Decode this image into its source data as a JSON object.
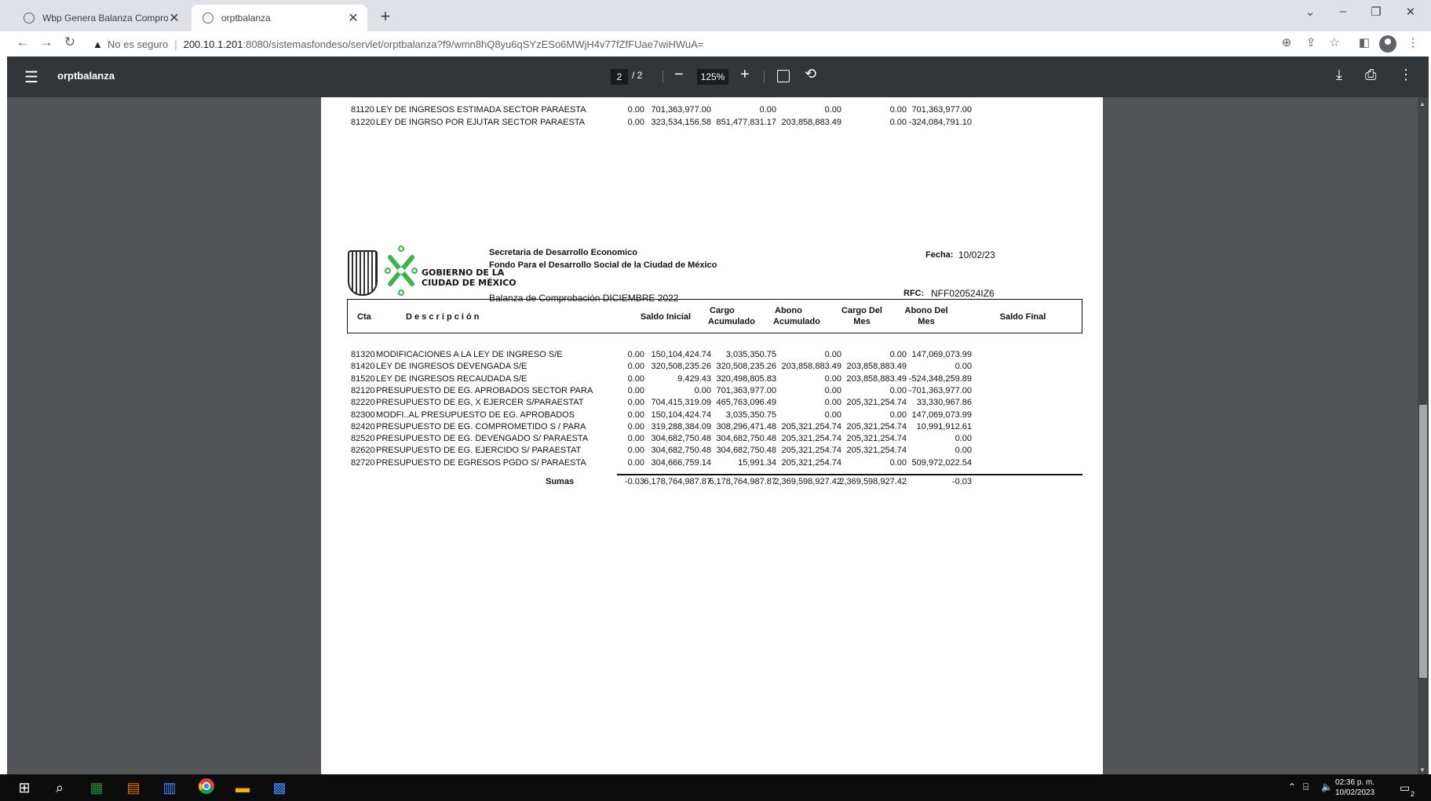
{
  "browser": {
    "tabs": [
      {
        "title": "Wbp Genera Balanza Comprobac"
      },
      {
        "title": "orptbalanza"
      }
    ],
    "new_tab_symbol": "+",
    "security_label": "No es seguro",
    "url_host": "200.10.1.201",
    "url_path": ":8080/sistemasfondeso/servlet/orptbalanza?f9/wmn8hQ8yu6qSYzESo6MWjH4v77fZfFUae7wiHWuA="
  },
  "pdf_toolbar": {
    "title": "orptbalanza",
    "current_page": "2",
    "page_total": "/ 2",
    "zoom": "125%"
  },
  "page1_rows": [
    {
      "cta": "81120",
      "desc": "LEY DE INGRESOS ESTIMADA SECTOR PARAESTA",
      "saldo_inicial": "0.00",
      "cargo_acum": "701,363,977.00",
      "abono_acum": "0.00",
      "cargo_mes": "0.00",
      "abono_mes": "0.00",
      "saldo_final": "701,363,977.00"
    },
    {
      "cta": "81220",
      "desc": "LEY DE INGRSO POR EJUTAR SECTOR PARAESTA",
      "saldo_inicial": "0.00",
      "cargo_acum": "323,534,156.58",
      "abono_acum": "851,477,831.17",
      "cargo_mes": "203,858,883.49",
      "abono_mes": "0.00",
      "saldo_final": "-324,084,791.10"
    }
  ],
  "report": {
    "org_line1": "Secretaria de Desarrollo Economico",
    "org_line2": "Fondo Para el Desarrollo Social de la Ciudad de México",
    "title": "Balanza de Comprobación DICIEMBRE 2022",
    "fecha_label": "Fecha:",
    "fecha_value": "10/02/23",
    "rfc_label": "RFC:",
    "rfc_value": "NFF020524IZ6",
    "logo_text_1": "GOBIERNO DE LA",
    "logo_text_2": "CIUDAD DE MÉXICO",
    "headers": {
      "cta": "Cta",
      "desc": "D e s c r i p c i ó n",
      "saldo_inicial": "Saldo Inicial",
      "cargo_acum_1": "Cargo",
      "cargo_acum_2": "Acumulado",
      "abono_acum_1": "Abono",
      "abono_acum_2": "Acumulado",
      "cargo_mes_1": "Cargo Del",
      "cargo_mes_2": "Mes",
      "abono_mes_1": "Abono Del",
      "abono_mes_2": "Mes",
      "saldo_final": "Saldo Final"
    },
    "rows": [
      {
        "cta": "81320",
        "desc": "MODIFICACIONES A LA LEY DE INGRESO S/E",
        "saldo_inicial": "0.00",
        "cargo_acum": "150,104,424.74",
        "abono_acum": "3,035,350.75",
        "cargo_mes": "0.00",
        "abono_mes": "0.00",
        "saldo_final": "147,069,073.99"
      },
      {
        "cta": "81420",
        "desc": "LEY DE INGRESOS DEVENGADA S/E",
        "saldo_inicial": "0.00",
        "cargo_acum": "320,508,235.26",
        "abono_acum": "320,508,235.26",
        "cargo_mes": "203,858,883.49",
        "abono_mes": "203,858,883.49",
        "saldo_final": "0.00"
      },
      {
        "cta": "81520",
        "desc": "LEY DE INGRESOS RECAUDADA S/E",
        "saldo_inicial": "0.00",
        "cargo_acum": "9,429.43",
        "abono_acum": "320,498,805.83",
        "cargo_mes": "0.00",
        "abono_mes": "203,858,883.49",
        "saldo_final": "-524,348,259.89"
      },
      {
        "cta": "82120",
        "desc": "PRESUPUESTO DE EG. APROBADOS SECTOR PARA",
        "saldo_inicial": "0.00",
        "cargo_acum": "0.00",
        "abono_acum": "701,363,977.00",
        "cargo_mes": "0.00",
        "abono_mes": "0.00",
        "saldo_final": "-701,363,977.00"
      },
      {
        "cta": "82220",
        "desc": "PRESUPUESTO DE EG, X EJERCER S/PARAESTAT",
        "saldo_inicial": "0.00",
        "cargo_acum": "704,415,319.09",
        "abono_acum": "465,763,096.49",
        "cargo_mes": "0.00",
        "abono_mes": "205,321,254.74",
        "saldo_final": "33,330,967.86"
      },
      {
        "cta": "82300",
        "desc": "MODFI..AL PRESUPUESTO DE EG. APROBADOS",
        "saldo_inicial": "0.00",
        "cargo_acum": "150,104,424.74",
        "abono_acum": "3,035,350.75",
        "cargo_mes": "0.00",
        "abono_mes": "0.00",
        "saldo_final": "147,069,073.99"
      },
      {
        "cta": "82420",
        "desc": "PRESUPUESTO DE EG. COMPROMETIDO S / PARA",
        "saldo_inicial": "0.00",
        "cargo_acum": "319,288,384.09",
        "abono_acum": "308,296,471.48",
        "cargo_mes": "205,321,254.74",
        "abono_mes": "205,321,254.74",
        "saldo_final": "10,991,912.61"
      },
      {
        "cta": "82520",
        "desc": "PRESUPUESTO DE EG. DEVENGADO S/ PARAESTA",
        "saldo_inicial": "0.00",
        "cargo_acum": "304,682,750.48",
        "abono_acum": "304,682,750.48",
        "cargo_mes": "205,321,254.74",
        "abono_mes": "205,321,254.74",
        "saldo_final": "0.00"
      },
      {
        "cta": "82620",
        "desc": "PRESUPUESTO DE EG. EJERCIDO S/ PARAESTAT",
        "saldo_inicial": "0.00",
        "cargo_acum": "304,682,750.48",
        "abono_acum": "304,682,750.48",
        "cargo_mes": "205,321,254.74",
        "abono_mes": "205,321,254.74",
        "saldo_final": "0.00"
      },
      {
        "cta": "82720",
        "desc": "PRESUPUESTO DE EGRESOS  PGDO S/ PARAESTA",
        "saldo_inicial": "0.00",
        "cargo_acum": "304,666,759.14",
        "abono_acum": "15,991.34",
        "cargo_mes": "205,321,254.74",
        "abono_mes": "0.00",
        "saldo_final": "509,972,022.54"
      }
    ],
    "sumas": {
      "label": "Sumas",
      "saldo_inicial": "-0.03",
      "cargo_acum": "6,178,764,987.87",
      "abono_acum": "6,178,764,987.87",
      "cargo_mes": "2,369,598,927.42",
      "abono_mes": "2,369,598,927.42",
      "saldo_final": "-0.03"
    }
  },
  "taskbar": {
    "clock_time": "02:36 p. m.",
    "clock_date": "10/02/2023",
    "notification_count": "2"
  },
  "colors": {
    "viewer_bg": "#525659",
    "pdf_toolbar_bg": "#323639",
    "cdmx_green": "#3bb54a"
  }
}
